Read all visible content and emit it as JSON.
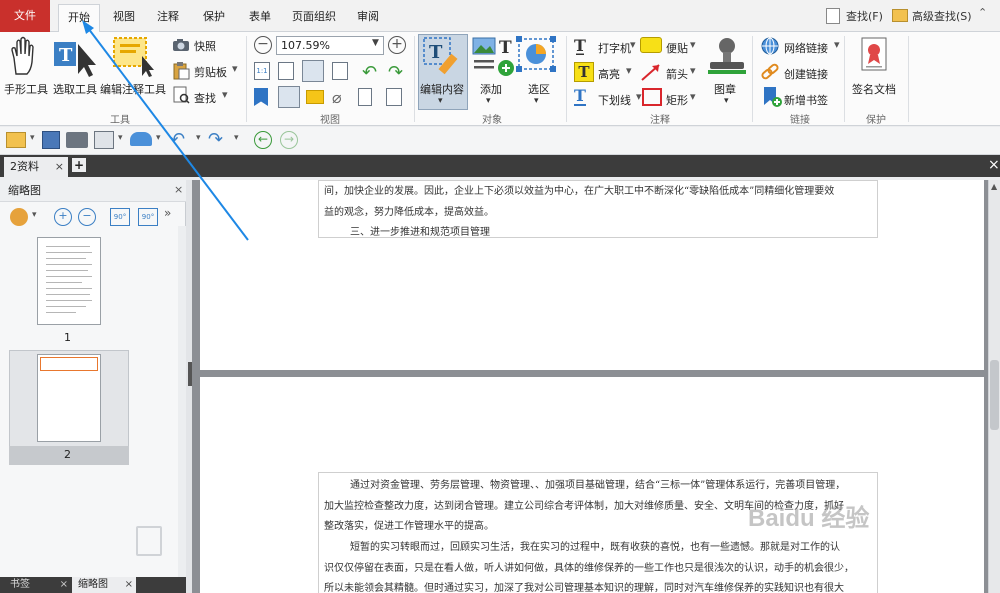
{
  "menubar": {
    "file": "文件",
    "tabs": [
      {
        "label": "开始"
      },
      {
        "label": "视图"
      },
      {
        "label": "注释"
      },
      {
        "label": "保护"
      },
      {
        "label": "表单"
      },
      {
        "label": "页面组织"
      },
      {
        "label": "审阅"
      }
    ],
    "find_label": "查找(F)",
    "advanced_find_label": "高级查找(S)"
  },
  "ribbon": {
    "tools": {
      "hand": "手形工具",
      "select": "选取工具",
      "select_annotation": "编辑注释工具",
      "snapshot": "快照",
      "clipboard": "剪贴板",
      "find": "查找",
      "group_label": "工具"
    },
    "view": {
      "zoom_value": "107.59%",
      "group_label": "视图"
    },
    "object": {
      "edit_content": "编辑内容",
      "add": "添加",
      "select_area": "选区",
      "group_label": "对象"
    },
    "comment": {
      "typewriter": "打字机",
      "note": "便贴",
      "highlight": "高亮",
      "arrow": "箭头",
      "underline": "下划线",
      "rectangle": "矩形",
      "stamp": "图章",
      "group_label": "注释"
    },
    "link": {
      "web_link": "网络链接",
      "create_link": "创建链接",
      "new_bookmark": "新增书签",
      "group_label": "链接"
    },
    "protect": {
      "sign": "签名文档",
      "group_label": "保护"
    }
  },
  "doc_tab": "2资料",
  "thumbnail_panel": {
    "title": "缩略图",
    "pages": [
      {
        "number": "1"
      },
      {
        "number": "2"
      }
    ]
  },
  "bottom_tabs": {
    "bookmarks": "书签",
    "thumbnails": "缩略图"
  },
  "document": {
    "page1_lines": [
      "间，加快企业的发展。因此，企业上下必须以效益为中心，在广大职工中不断深化“零缺陷低成本”同精细化管理要效",
      "益的观念，努力降低成本，提高效益。",
      "三、进一步推进和规范项目管理"
    ],
    "page2_lines": [
      "通过对资金管理、劳务层管理、物资管理、、加强项目基础管理，结合“三标一体”管理体系运行，完善项目管理，",
      "加大监控检查整改力度，达到闭合管理。建立公司综合考评体制，加大对维修质量、安全、文明车间的检查力度，抓好",
      "整改落实，促进工作管理水平的提高。",
      "短暂的实习转眼而过，回顾实习生活，我在实习的过程中，既有收获的喜悦，也有一些遗憾。那就是对工作的认",
      "识仅仅停留在表面，只是在看人做，听人讲如何做，具体的维修保养的一些工作也只是很浅次的认识，动手的机会很少，",
      "所以未能领会其精髓。但时通过实习，加深了我对公司管理基本知识的理解，同时对汽车维修保养的实践知识也有很大"
    ]
  },
  "watermark": "Baidu 经验",
  "colors": {
    "accent": "#c9302c",
    "annotation_arrow": "#1e88e5"
  }
}
